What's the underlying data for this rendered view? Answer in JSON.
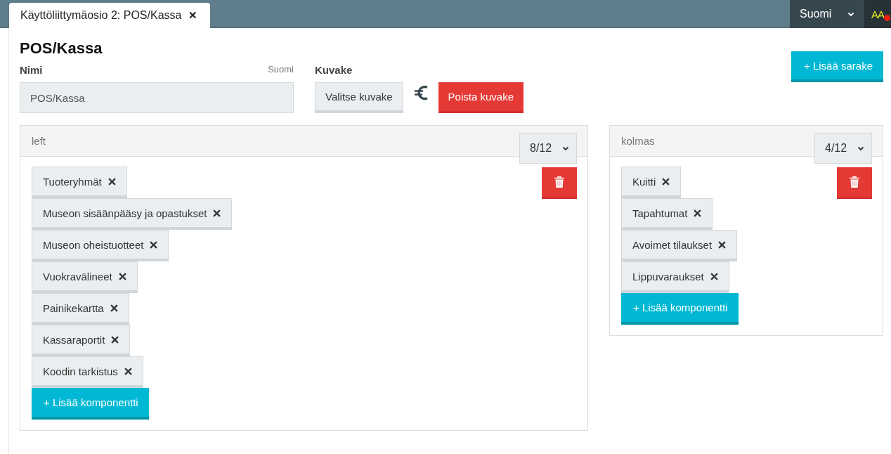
{
  "tabs": [
    {
      "label": "Käyttöliittymäosio 2: POS/Kassa",
      "close": "✕",
      "selected": true
    }
  ],
  "language_menu": {
    "value": "Suomi"
  },
  "user_badge": {
    "initials": "AA",
    "notification": true
  },
  "page_title": "POS/Kassa",
  "name_field": {
    "label": "Nimi",
    "language": "Suomi",
    "value": "POS/Kassa"
  },
  "icon_field": {
    "label": "Kuvake",
    "choose_button": "Valitse kuvake",
    "remove_button": "Poista kuvake"
  },
  "add_column_button": "+ Lisää sarake",
  "columns": [
    {
      "name": "left",
      "width": "8/12",
      "components": [
        {
          "label": "Tuoteryhmät"
        },
        {
          "label": "Museon sisäänpääsy ja opastukset"
        },
        {
          "label": "Museon oheistuotteet"
        },
        {
          "label": "Vuokravälineet"
        },
        {
          "label": "Painikekartta"
        },
        {
          "label": "Kassaraportit"
        },
        {
          "label": "Koodin tarkistus"
        }
      ],
      "add_button": "+ Lisää komponentti"
    },
    {
      "name": "kolmas",
      "width": "4/12",
      "components": [
        {
          "label": "Kuitti"
        },
        {
          "label": "Tapahtumat"
        },
        {
          "label": "Avoimet tilaukset"
        },
        {
          "label": "Lippuvaraukset"
        }
      ],
      "add_button": "+ Lisää komponentti"
    }
  ]
}
